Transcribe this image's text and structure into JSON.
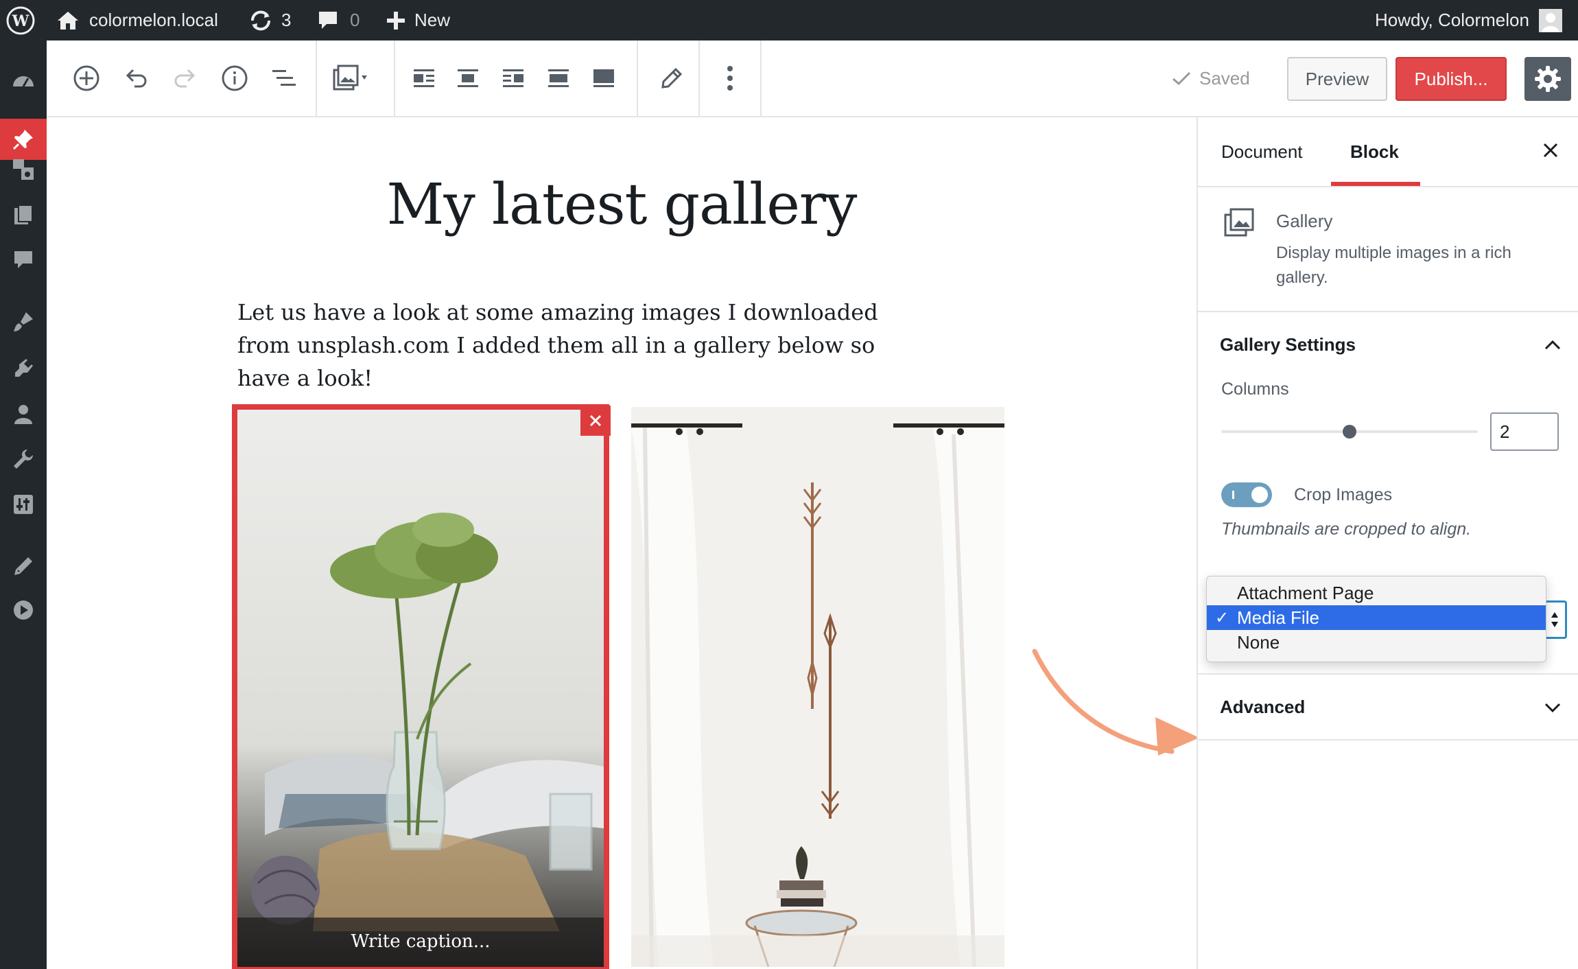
{
  "admin_bar": {
    "site_name": "colormelon.local",
    "updates_count": "3",
    "comments_count": "0",
    "new_label": "New",
    "greeting": "Howdy, Colormelon"
  },
  "toolbar": {
    "saved_label": "Saved",
    "preview_label": "Preview",
    "publish_label": "Publish..."
  },
  "post": {
    "title": "My latest gallery",
    "paragraph": "Let us have a look at some amazing images I downloaded from unsplash.com I added them all in a gallery below so have a look!",
    "caption_placeholder": "Write caption..."
  },
  "sidebar": {
    "tabs": [
      {
        "label": "Document"
      },
      {
        "label": "Block"
      }
    ],
    "active_tab": "Block",
    "block": {
      "name": "Gallery",
      "description": "Display multiple images in a rich gallery."
    },
    "gallery_settings": {
      "title": "Gallery Settings",
      "columns_label": "Columns",
      "columns_value": "2",
      "columns_slider_fraction": 0.5,
      "crop_label": "Crop Images",
      "crop_enabled": true,
      "crop_help": "Thumbnails are cropped to align.",
      "link_options": [
        "Attachment Page",
        "Media File",
        "None"
      ],
      "link_selected": "Media File"
    },
    "advanced": {
      "title": "Advanced"
    }
  },
  "colors": {
    "accent": "#dd3b3d",
    "admin_bg": "#23282d",
    "selection": "#2d6ce6",
    "annotation_arrow": "#f4a07b"
  }
}
